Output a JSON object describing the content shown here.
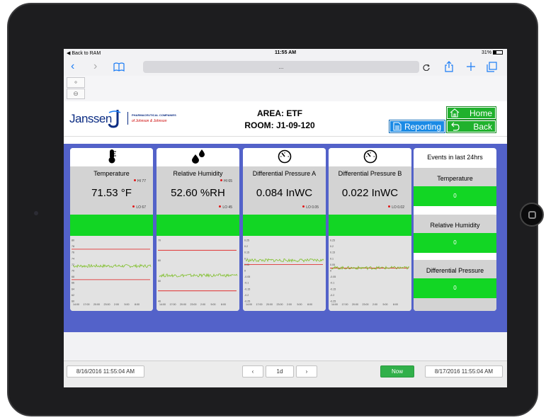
{
  "status_bar": {
    "back_label": "◀ Back to RAM",
    "time": "11:55 AM",
    "battery": "31%"
  },
  "browser": {
    "url": "...",
    "icons": [
      "back-icon",
      "forward-icon",
      "bookmarks-icon",
      "reload-icon",
      "share-icon",
      "new-tab-icon",
      "tabs-icon"
    ]
  },
  "header": {
    "logo_text": "Janssen",
    "logo_sub1": "PHARMACEUTICAL COMPANIES",
    "logo_sub2": "of Johnson & Johnson",
    "area": "AREA: ETF",
    "room": "ROOM: J1-09-120",
    "home_label": "Home",
    "reporting_label": "Reporting",
    "back_label": "Back"
  },
  "cards": [
    {
      "name": "Temperature",
      "icon": "thermometer-icon",
      "value": "71.53 °F",
      "hi_label": "HI 77",
      "lo_label": "LO 67",
      "chart": {
        "y_ticks": [
          "80",
          "78",
          "76",
          "74",
          "72",
          "70",
          "68",
          "66",
          "64",
          "62",
          "60"
        ],
        "x_ticks": [
          "14:00",
          "17:00",
          "20:00",
          "23:00",
          "2:00",
          "5:00",
          "8:00"
        ],
        "ylim": [
          60,
          80
        ],
        "hi": 77,
        "lo": 67,
        "level": 71.5
      }
    },
    {
      "name": "Relative Humidity",
      "icon": "droplets-icon",
      "value": "52.60 %RH",
      "hi_label": "HI 65",
      "lo_label": "LO 45",
      "chart": {
        "y_ticks": [
          "70",
          "60",
          "50",
          "40"
        ],
        "x_ticks": [
          "14:00",
          "17:00",
          "20:00",
          "23:00",
          "2:00",
          "5:00",
          "8:00"
        ],
        "ylim": [
          40,
          70
        ],
        "hi": 65,
        "lo": 45,
        "level": 52.6
      }
    },
    {
      "name": "Differential Pressure A",
      "icon": "gauge-icon",
      "value": "0.084 InWC",
      "hi_label": "",
      "lo_label": "LO 0.05",
      "chart": {
        "y_ticks": [
          "0.25",
          "0.2",
          "0.15",
          "0.1",
          "0.05",
          "0",
          "-0.05",
          "-0.1",
          "-0.15",
          "-0.2",
          "-0.25"
        ],
        "x_ticks": [
          "14:00",
          "17:00",
          "20:00",
          "23:00",
          "2:00",
          "5:00",
          "8:00"
        ],
        "ylim": [
          -0.25,
          0.25
        ],
        "hi": null,
        "lo": 0.05,
        "level": 0.084
      }
    },
    {
      "name": "Differential Pressure B",
      "icon": "gauge-icon",
      "value": "0.022 InWC",
      "hi_label": "",
      "lo_label": "LO 0.02",
      "chart": {
        "y_ticks": [
          "0.25",
          "0.2",
          "0.15",
          "0.1",
          "0.05",
          "0",
          "-0.05",
          "-0.1",
          "-0.15",
          "-0.2",
          "-0.25"
        ],
        "x_ticks": [
          "14:00",
          "17:00",
          "20:00",
          "23:00",
          "2:00",
          "5:00",
          "8:00"
        ],
        "ylim": [
          -0.25,
          0.25
        ],
        "hi": null,
        "lo": 0.02,
        "level": 0.022
      }
    }
  ],
  "events": {
    "title": "Events in last 24hrs",
    "items": [
      {
        "label": "Temperature",
        "count": "0"
      },
      {
        "label": "Relative Humidity",
        "count": "0"
      },
      {
        "label": "Differential Pressure",
        "count": "0"
      }
    ]
  },
  "footer": {
    "start": "8/16/2016 11:55:04 AM",
    "range": "1d",
    "now": "Now",
    "end": "8/17/2016 11:55:04 AM"
  },
  "colors": {
    "accent_blue": "#5362c9",
    "status_green": "#12d624",
    "limit_red": "#e01818",
    "trace_green": "#7fbf2a"
  }
}
